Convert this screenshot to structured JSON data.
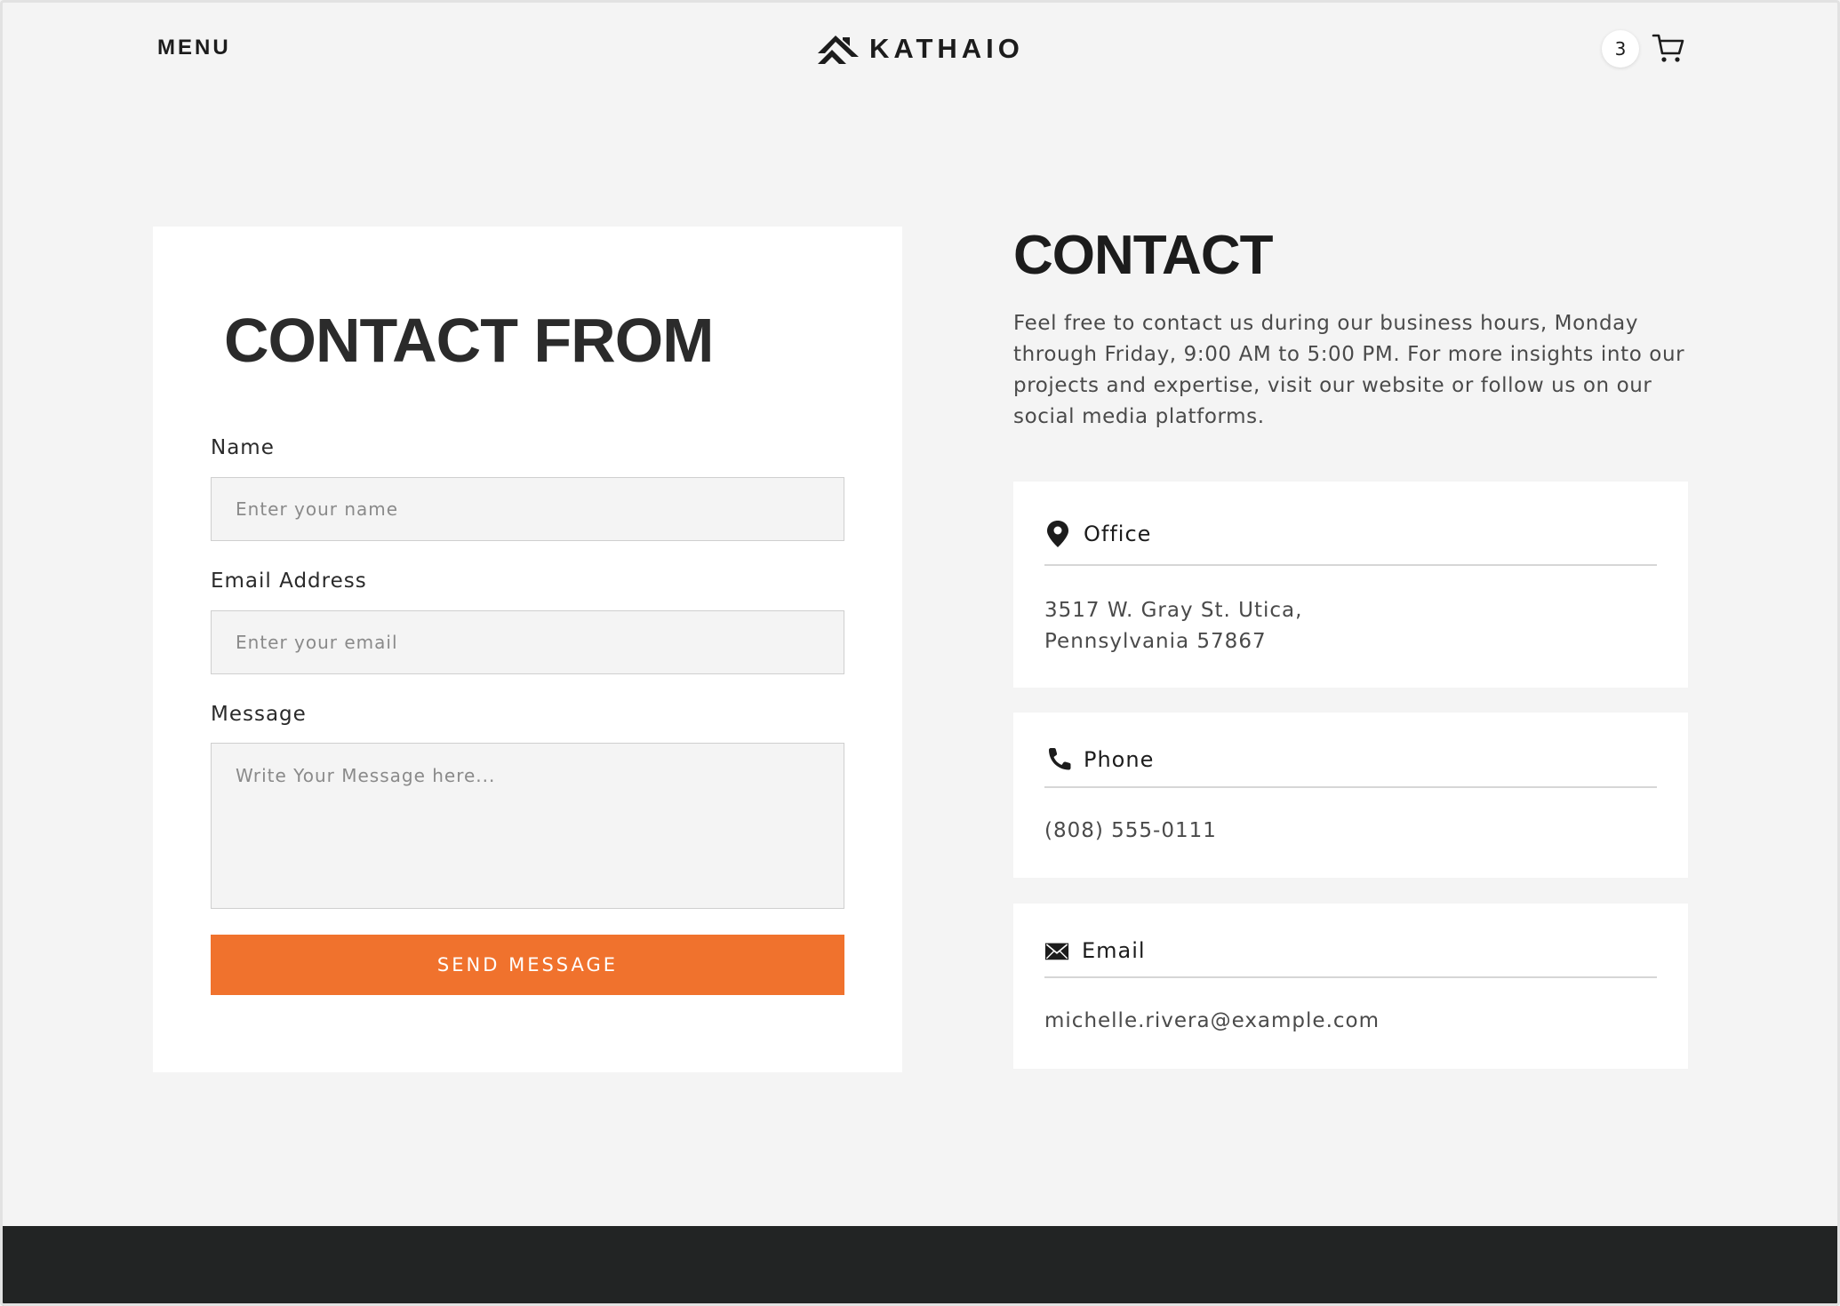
{
  "header": {
    "menu_label": "MENU",
    "brand_name": "KATHAIO",
    "cart_count": "3"
  },
  "form": {
    "title": "CONTACT FROM",
    "fields": {
      "name": {
        "label": "Name",
        "placeholder": "Enter your name"
      },
      "email": {
        "label": "Email Address",
        "placeholder": "Enter your email"
      },
      "message": {
        "label": "Message",
        "placeholder": "Write Your Message here..."
      }
    },
    "submit_label": "SEND MESSAGE"
  },
  "contact": {
    "title": "CONTACT",
    "description": "Feel free to contact us during our business hours, Monday through Friday, 9:00 AM to 5:00 PM. For more insights into our projects and expertise, visit our website or follow us on our social media platforms.",
    "cards": {
      "office": {
        "icon": "map-pin-icon",
        "label": "Office",
        "value": "3517 W. Gray St. Utica,\nPennsylvania 57867"
      },
      "phone": {
        "icon": "phone-icon",
        "label": "Phone",
        "value": "(808) 555-0111"
      },
      "email": {
        "icon": "envelope-icon",
        "label": "Email",
        "value": "michelle.rivera@example.com"
      }
    }
  },
  "colors": {
    "accent": "#f0722d",
    "background": "#f4f4f4",
    "footer": "#222424",
    "text_dark": "#1c1c1c"
  }
}
